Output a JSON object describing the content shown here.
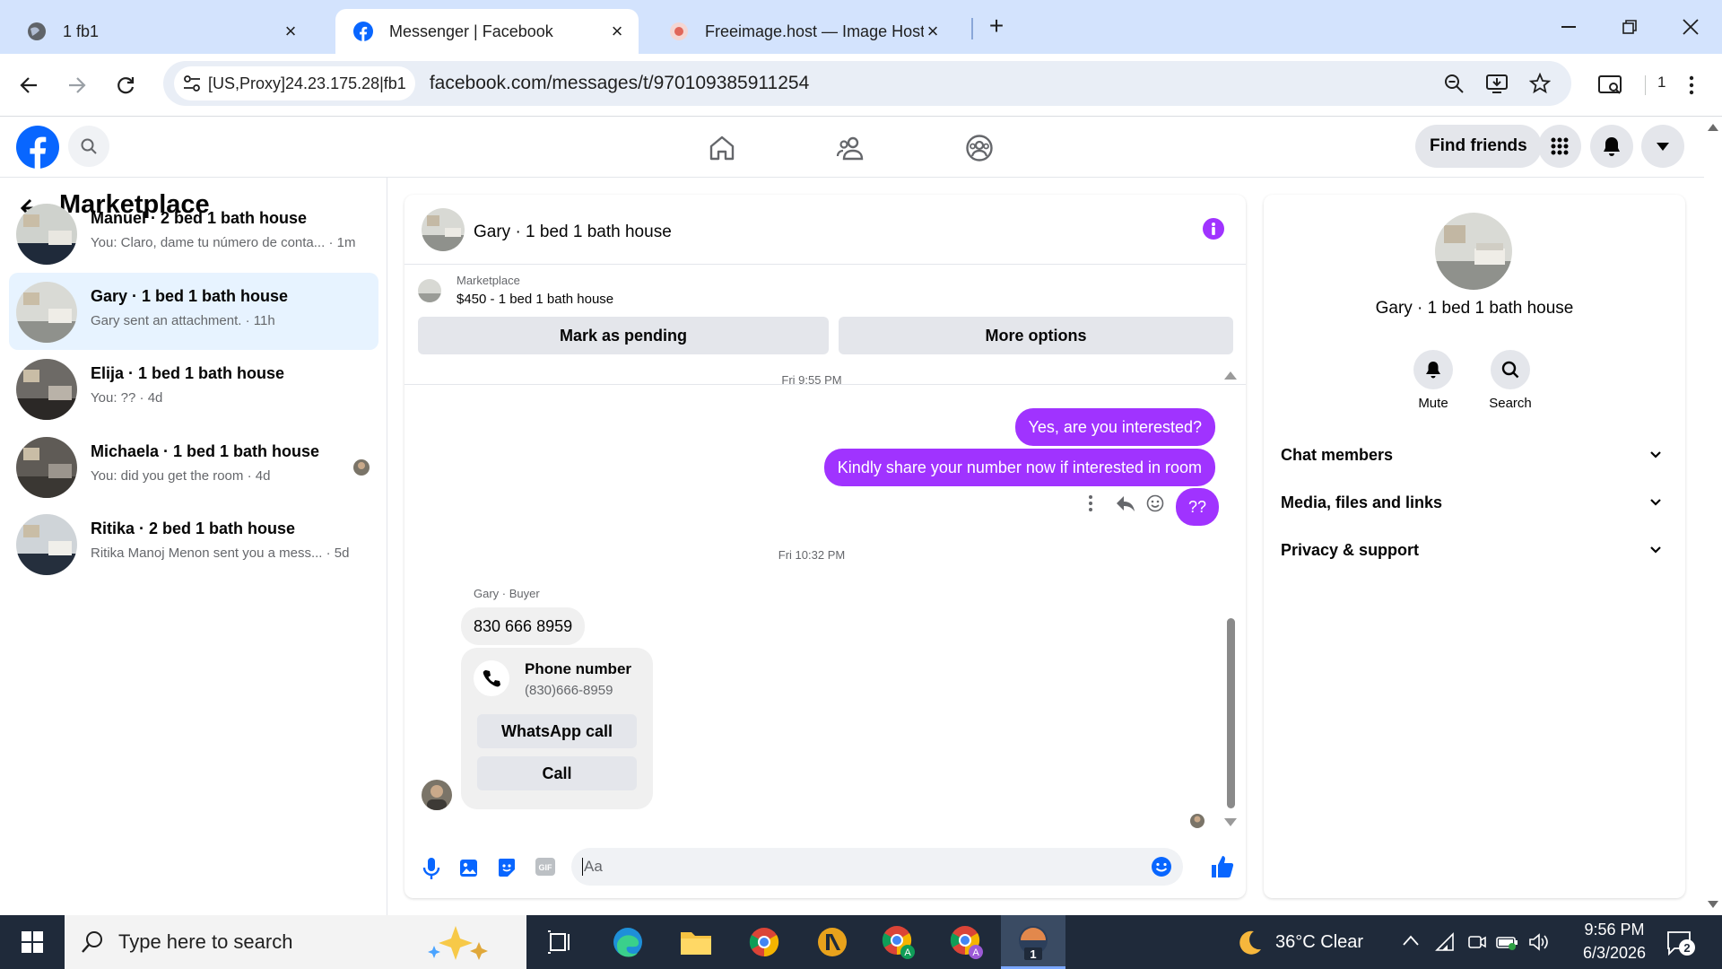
{
  "browser": {
    "tabs": [
      {
        "title": "1 fb1",
        "icon": "globe-icon"
      },
      {
        "title": "Messenger | Facebook",
        "icon": "facebook-icon"
      },
      {
        "title": "Freeimage.host — Image Hosti",
        "icon": "freeimage-icon"
      }
    ],
    "site_info": "[US,Proxy]24.23.175.28|fb1",
    "url": "facebook.com/messages/t/970109385911254",
    "extension_count": "1"
  },
  "fb_header": {
    "find_friends": "Find friends"
  },
  "left_panel": {
    "title": "Marketplace",
    "conversations": [
      {
        "name": "Manuel · 2 bed 1 bath house",
        "preview": "You: Claro, dame tu número de conta...",
        "time": "1m"
      },
      {
        "name": "Gary · 1 bed 1 bath house",
        "preview": "Gary sent an attachment.",
        "time": "11h"
      },
      {
        "name": "Elija · 1 bed 1 bath house",
        "preview": "You: ??",
        "time": "4d"
      },
      {
        "name": "Michaela · 1 bed 1 bath house",
        "preview": "You: did you get the room",
        "time": "4d"
      },
      {
        "name": "Ritika · 2 bed 1 bath house",
        "preview": "Ritika Manoj Menon sent you a mess...",
        "time": "5d"
      }
    ]
  },
  "chat": {
    "title": "Gary · 1 bed 1 bath house",
    "listing": {
      "source": "Marketplace",
      "summary": "$450 - 1 bed 1 bath house",
      "mark_pending": "Mark as pending",
      "more_options": "More options"
    },
    "timestamp1": "Fri 9:55 PM",
    "outgoing": [
      "Yes, are you interested?",
      "Kindly share your number now if interested in room",
      "??"
    ],
    "timestamp2": "Fri 10:32 PM",
    "sender_label": "Gary · Buyer",
    "incoming_text": "830 666 8959",
    "phone_card": {
      "title": "Phone number",
      "number": "(830)666-8959",
      "whatsapp": "WhatsApp call",
      "call": "Call"
    },
    "composer_placeholder": "Aa"
  },
  "right_panel": {
    "name": "Gary · 1 bed 1 bath house",
    "mute": "Mute",
    "search": "Search",
    "sections": [
      "Chat members",
      "Media, files and links",
      "Privacy & support"
    ]
  },
  "taskbar": {
    "search_placeholder": "Type here to search",
    "weather": "36°C  Clear",
    "time": "9:56 PM",
    "date": "6/3/2026",
    "notifications": "2"
  },
  "colors": {
    "facebook_blue": "#0866ff",
    "message_purple": "#a033ff",
    "active_conversation": "#e7f3ff"
  }
}
